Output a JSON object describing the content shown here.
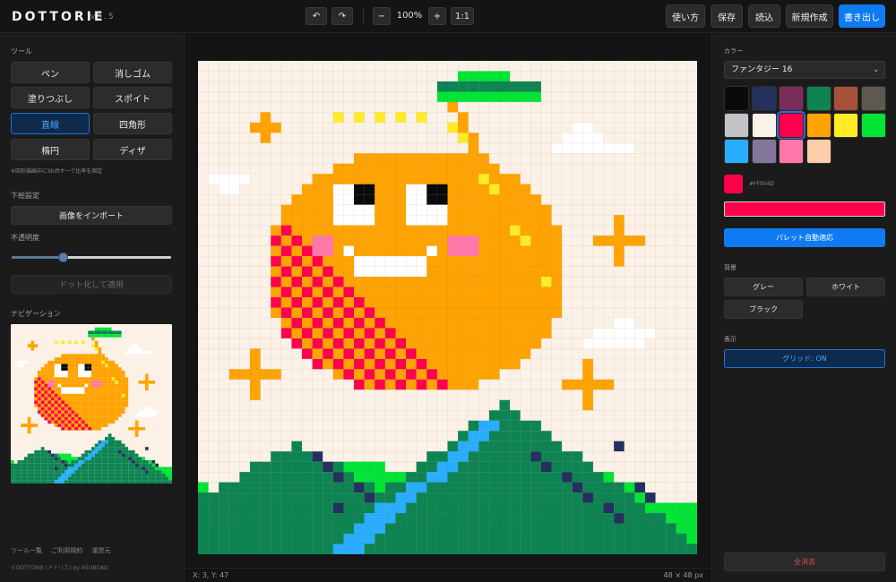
{
  "header": {
    "logo": "DOTTORIE",
    "version": "v3.5",
    "undo_label": "↶",
    "redo_label": "↷",
    "zoom_out_label": "−",
    "zoom_value": "100%",
    "zoom_in_label": "+",
    "zoom_reset_label": "1:1",
    "help_label": "使い方",
    "save_label": "保存",
    "load_label": "読込",
    "new_label": "新規作成",
    "export_label": "書き出し"
  },
  "left": {
    "tools_heading": "ツール",
    "tools": [
      "ペン",
      "消しゴム",
      "塗りつぶし",
      "スポイト",
      "直線",
      "四角形",
      "楕円",
      "ディザ"
    ],
    "active_tool": "直線",
    "hint": "※図形描画中にShiftキーで比率を固定",
    "underlay_heading": "下絵設定",
    "import_label": "画像をインポート",
    "opacity_label": "不透明度",
    "opacity_value": 0.32,
    "apply_label": "ドット化して適用",
    "nav_heading": "ナビゲーション",
    "footer_links": [
      "ツール一覧",
      "ご利用規約",
      "運営元"
    ],
    "copyright": "©DOTTORIE (ドトリエ) by ASOBOAD"
  },
  "status": {
    "coords": "X: 3, Y: 47",
    "size": "48 × 48 px"
  },
  "right": {
    "color_heading": "カラー",
    "palette_name": "ファンタジー 16",
    "palette": [
      "#0a0a0a",
      "#24305e",
      "#7b2d5a",
      "#0e8452",
      "#a8513a",
      "#5e5850",
      "#c2c3c7",
      "#fbf1e7",
      "#ff004d",
      "#ffa300",
      "#ffec27",
      "#00e436",
      "#29adff",
      "#83769c",
      "#ff77a8",
      "#ffccaa"
    ],
    "selected_index": 8,
    "current_color": "#ff004d",
    "hex_label": "#FF004D",
    "auto_palette_label": "パレット自動適応",
    "bg_heading": "背景",
    "bg_gray": "グレー",
    "bg_white": "ホワイト",
    "bg_black": "ブラック",
    "display_heading": "表示",
    "grid_label": "グリッド: ON",
    "clear_label": "全消去"
  }
}
